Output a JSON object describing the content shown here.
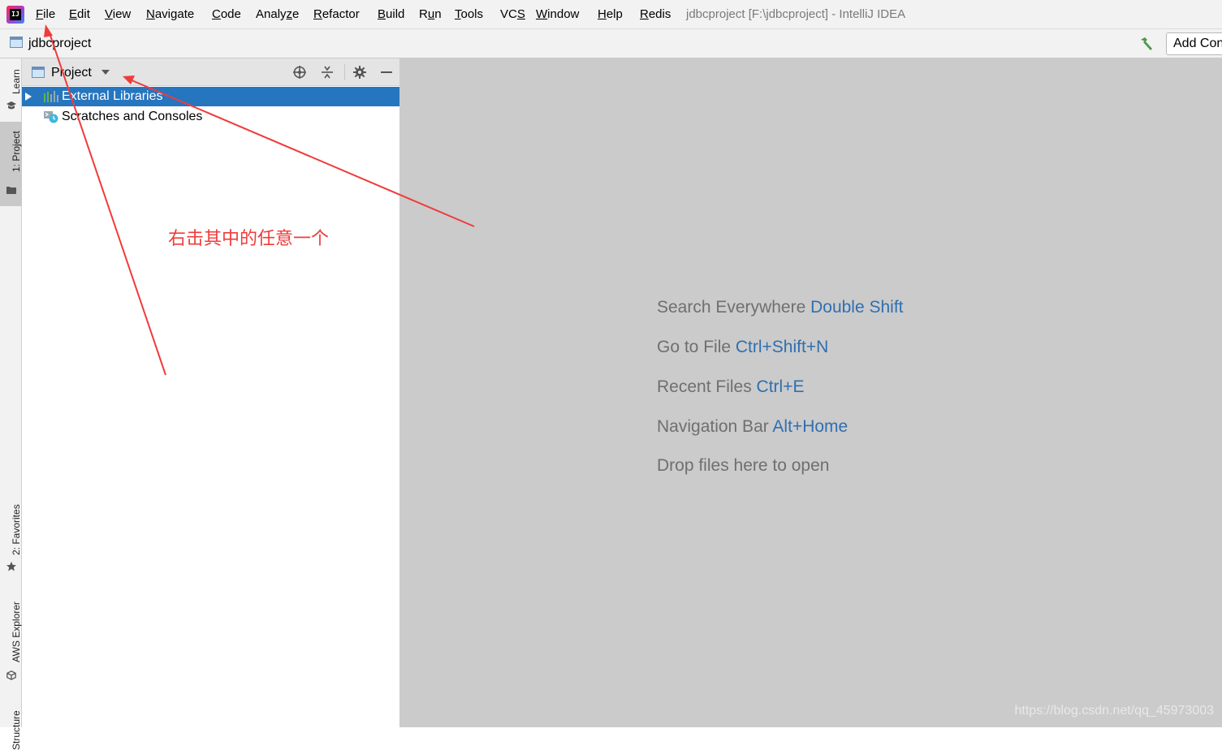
{
  "menubar": {
    "items": [
      {
        "mnemonic": "F",
        "rest": "ile"
      },
      {
        "mnemonic": "E",
        "rest": "dit"
      },
      {
        "mnemonic": "V",
        "rest": "iew"
      },
      {
        "mnemonic": "N",
        "rest": "avigate"
      },
      {
        "mnemonic": "C",
        "rest": "ode"
      },
      {
        "pre": "Analy",
        "mnemonic": "z",
        "rest": "e"
      },
      {
        "mnemonic": "R",
        "rest": "efactor"
      },
      {
        "mnemonic": "B",
        "rest": "uild"
      },
      {
        "pre": "R",
        "mnemonic": "u",
        "rest": "n"
      },
      {
        "mnemonic": "T",
        "rest": "ools"
      },
      {
        "pre": "VC",
        "mnemonic": "S",
        "rest": ""
      },
      {
        "mnemonic": "W",
        "rest": "indow"
      },
      {
        "mnemonic": "H",
        "rest": "elp"
      },
      {
        "mnemonic": "R",
        "rest": "edis"
      }
    ],
    "window_title": "jdbcproject [F:\\jdbcproject] - IntelliJ IDEA"
  },
  "navbar": {
    "project_name": "jdbcproject",
    "add_config_label": "Add Configuration..."
  },
  "left_strip": {
    "learn": "Learn",
    "project": "1: Project",
    "favorites": "2: Favorites",
    "aws": "AWS Explorer",
    "structure": "Structure"
  },
  "project_panel": {
    "view_label": "Project",
    "tree": [
      {
        "label": "External Libraries",
        "selected": true
      },
      {
        "label": "Scratches and Consoles",
        "selected": false
      }
    ]
  },
  "annotation": {
    "text": "右击其中的任意一个",
    "color": "#f03b3b"
  },
  "editor": {
    "hints": [
      {
        "text": "Search Everywhere ",
        "key": "Double Shift"
      },
      {
        "text": "Go to File ",
        "key": "Ctrl+Shift+N"
      },
      {
        "text": "Recent Files ",
        "key": "Ctrl+E"
      },
      {
        "text": "Navigation Bar ",
        "key": "Alt+Home"
      },
      {
        "text": "Drop files here to open",
        "key": ""
      }
    ],
    "watermark": "https://blog.csdn.net/qq_45973003"
  },
  "colors": {
    "selection": "#2675bf",
    "editor_bg": "#cbcbcb",
    "shortcut": "#2f6fb0"
  }
}
